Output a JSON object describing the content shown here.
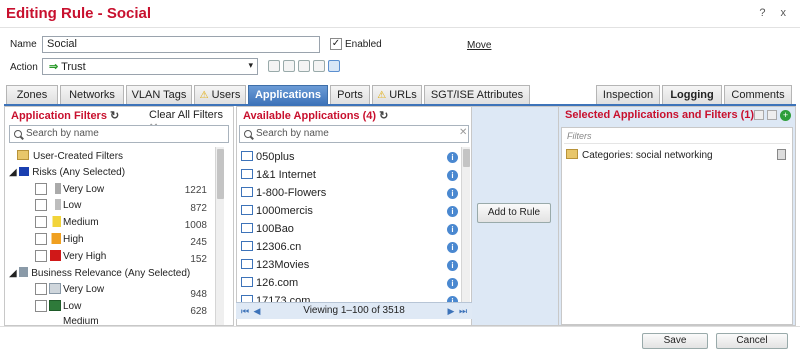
{
  "dialog": {
    "title": "Editing Rule - Social",
    "help_icon": "?",
    "close_icon": "x"
  },
  "form": {
    "name_label": "Name",
    "name_value": "Social",
    "enabled_label": "Enabled",
    "enabled_checked": true,
    "move_link": "Move",
    "action_label": "Action",
    "action_value": "Trust",
    "action_arrow": "⇒"
  },
  "tabs": [
    {
      "label": "Zones",
      "active": false
    },
    {
      "label": "Networks",
      "active": false
    },
    {
      "label": "VLAN Tags",
      "active": false
    },
    {
      "label": "Users",
      "warn": true,
      "active": false
    },
    {
      "label": "Applications",
      "active": true
    },
    {
      "label": "Ports",
      "active": false
    },
    {
      "label": "URLs",
      "warn": true,
      "active": false
    },
    {
      "label": "SGT/ISE Attributes",
      "active": false
    },
    {
      "label": "Inspection",
      "active": false
    },
    {
      "label": "Logging",
      "active": false,
      "bold": true
    },
    {
      "label": "Comments",
      "active": false
    }
  ],
  "filters_panel": {
    "title": "Application Filters",
    "clear_all": "Clear All Filters",
    "search_placeholder": "Search by name",
    "user_created": "User-Created Filters",
    "risks_header": "Risks (Any Selected)",
    "risks": [
      {
        "label": "Very Low",
        "count": "1221"
      },
      {
        "label": "Low",
        "count": "872"
      },
      {
        "label": "Medium",
        "count": "1008"
      },
      {
        "label": "High",
        "count": "245"
      },
      {
        "label": "Very High",
        "count": "152"
      }
    ],
    "business_header": "Business Relevance (Any Selected)",
    "business": [
      {
        "label": "Very Low",
        "count": "948"
      },
      {
        "label": "Low",
        "count": "628"
      },
      {
        "label": "Medium",
        "count": ""
      }
    ]
  },
  "apps_panel": {
    "title": "Available Applications (4)",
    "search_placeholder": "Search by name",
    "apps": [
      "050plus",
      "1&1 Internet",
      "1-800-Flowers",
      "1000mercis",
      "100Bao",
      "12306.cn",
      "123Movies",
      "126.com",
      "17173.com"
    ],
    "pager_text": "Viewing 1–100 of 3518"
  },
  "add_button": "Add to Rule",
  "selected_panel": {
    "title": "Selected Applications and Filters (1)",
    "filters_placeholder": "Filters",
    "items": [
      "Categories: social networking"
    ]
  },
  "footer": {
    "save": "Save",
    "cancel": "Cancel"
  },
  "colors": {
    "accent_red": "#c8102e",
    "tab_active": "#3d73b9"
  }
}
